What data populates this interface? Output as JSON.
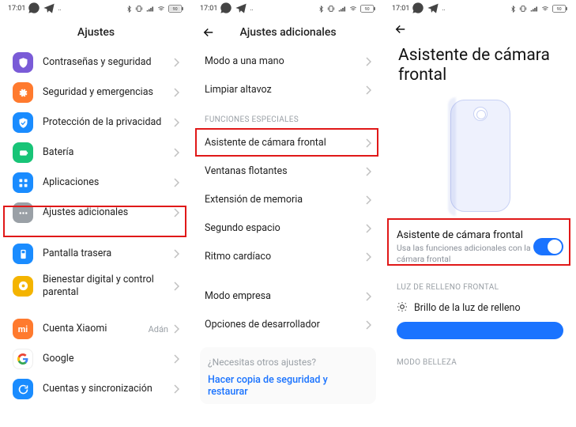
{
  "status": {
    "time": "17:01",
    "icons_left": [
      "whatsapp",
      "telegram",
      "more"
    ],
    "icons_right": [
      "bluetooth",
      "vibrate",
      "signal",
      "wifi",
      "battery"
    ],
    "battery_text": "90"
  },
  "screen1": {
    "title": "Ajustes",
    "items": [
      {
        "icon": "shield",
        "color": "#7a5bd7",
        "label": "Contraseñas y seguridad"
      },
      {
        "icon": "sos",
        "color": "#ff7a2e",
        "label": "Seguridad y emergencias"
      },
      {
        "icon": "shield-check",
        "color": "#1a8cff",
        "label": "Protección de la privacidad"
      },
      {
        "icon": "battery",
        "color": "#18c477",
        "label": "Batería"
      },
      {
        "icon": "apps",
        "color": "#1a8cff",
        "label": "Aplicaciones"
      },
      {
        "icon": "dots",
        "color": "#9aa0a6",
        "label": "Ajustes adicionales"
      },
      {
        "icon": "rear-display",
        "color": "#1a8cff",
        "label": "Pantalla trasera"
      },
      {
        "icon": "wellbeing",
        "color": "#f4b400",
        "label": "Bienestar digital y control parental"
      },
      {
        "icon": "mi",
        "color": "#ff7a2e",
        "label": "Cuenta Xiaomi",
        "sub": "Adán"
      },
      {
        "icon": "google",
        "color": "#ffffff",
        "label": "Google"
      },
      {
        "icon": "sync",
        "color": "#1a8cff",
        "label": "Cuentas y sincronización"
      }
    ],
    "highlight_index": 5
  },
  "screen2": {
    "title": "Ajustes adicionales",
    "top_items": [
      {
        "label": "Modo a una mano"
      },
      {
        "label": "Limpiar altavoz"
      }
    ],
    "section_label": "FUNCIONES ESPECIALES",
    "special_items": [
      {
        "label": "Asistente de cámara frontal"
      },
      {
        "label": "Ventanas flotantes"
      },
      {
        "label": "Extensión de memoria"
      },
      {
        "label": "Segundo espacio"
      },
      {
        "label": "Ritmo cardíaco"
      }
    ],
    "bottom_items": [
      {
        "label": "Modo empresa"
      },
      {
        "label": "Opciones de desarrollador"
      }
    ],
    "highlight_index": 0,
    "card_question": "¿Necesitas otros ajustes?",
    "card_link": "Hacer copia de seguridad y restaurar"
  },
  "screen3": {
    "title": "Asistente de cámara frontal",
    "toggle": {
      "title": "Asistente de cámara frontal",
      "desc": "Usa las funciones adicionales con la cámara frontal",
      "on": true
    },
    "section_fill": "LUZ DE RELLENO FRONTAL",
    "fill_label": "Brillo de la luz de relleno",
    "section_beauty": "MODO BELLEZA"
  }
}
